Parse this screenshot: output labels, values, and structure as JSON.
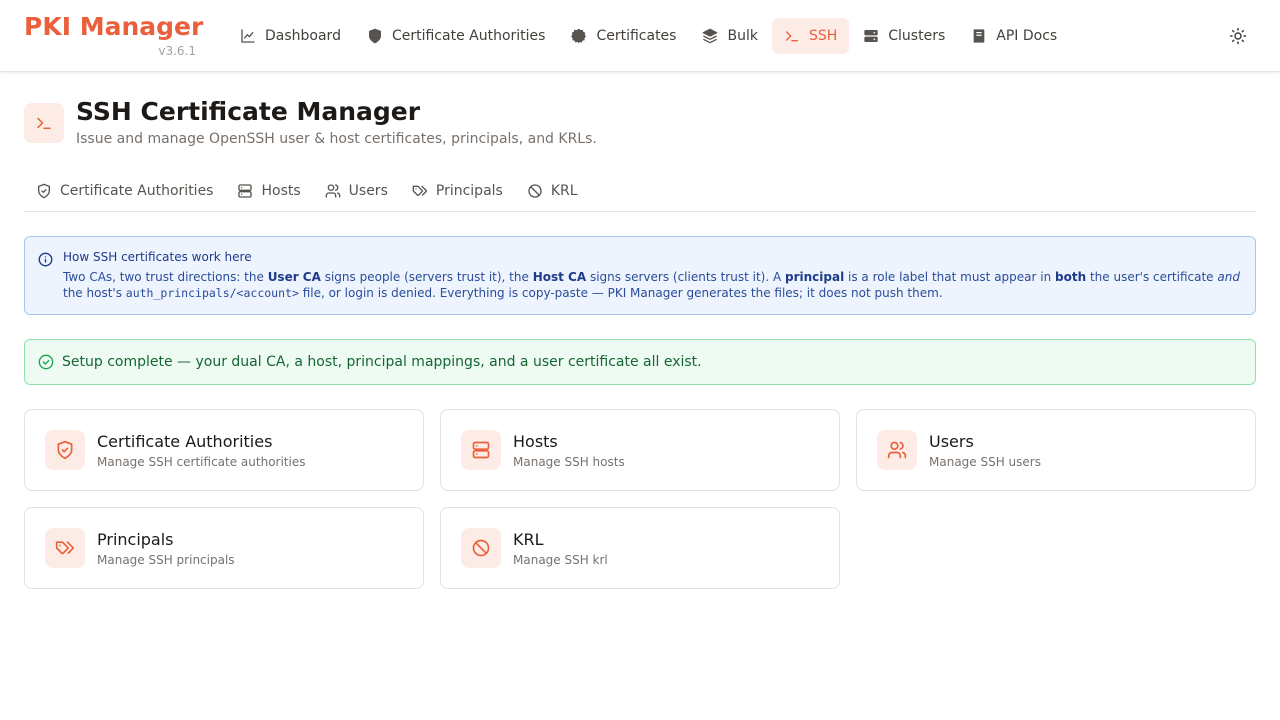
{
  "app": {
    "title": "PKI Manager",
    "version": "v3.6.1"
  },
  "nav": {
    "items": [
      {
        "label": "Dashboard",
        "icon": "chart-line-icon"
      },
      {
        "label": "Certificate Authorities",
        "icon": "shield-icon"
      },
      {
        "label": "Certificates",
        "icon": "badge-icon"
      },
      {
        "label": "Bulk",
        "icon": "layers-icon"
      },
      {
        "label": "SSH",
        "icon": "terminal-icon",
        "active": true
      },
      {
        "label": "Clusters",
        "icon": "server-icon"
      },
      {
        "label": "API Docs",
        "icon": "book-icon"
      }
    ],
    "theme_toggle": "sun-icon"
  },
  "page": {
    "title": "SSH Certificate Manager",
    "subtitle": "Issue and manage OpenSSH user & host certificates, principals, and KRLs."
  },
  "tabs": [
    {
      "label": "Certificate Authorities",
      "icon": "shield-check-icon"
    },
    {
      "label": "Hosts",
      "icon": "server-icon"
    },
    {
      "label": "Users",
      "icon": "users-icon"
    },
    {
      "label": "Principals",
      "icon": "tags-icon"
    },
    {
      "label": "KRL",
      "icon": "ban-icon"
    }
  ],
  "info": {
    "title": "How SSH certificates work here",
    "t1": "Two CAs, two trust directions: the ",
    "b1": "User CA",
    "t2": " signs people (servers trust it), the ",
    "b2": "Host CA",
    "t3": " signs servers (clients trust it). A ",
    "b3": "principal",
    "t4": " is a role label that must appear in ",
    "b4": "both",
    "t5": " the user's certificate ",
    "i1": "and",
    "t6": " the host's ",
    "code1": "auth_principals/<account>",
    "t7": " file, or login is denied. Everything is copy-paste — PKI Manager generates the files; it does not push them."
  },
  "success": {
    "message": "Setup complete — your dual CA, a host, principal mappings, and a user certificate all exist."
  },
  "cards": [
    {
      "title": "Certificate Authorities",
      "desc": "Manage SSH certificate authorities",
      "icon": "shield-check-icon"
    },
    {
      "title": "Hosts",
      "desc": "Manage SSH hosts",
      "icon": "server-icon"
    },
    {
      "title": "Users",
      "desc": "Manage SSH users",
      "icon": "users-icon"
    },
    {
      "title": "Principals",
      "desc": "Manage SSH principals",
      "icon": "tags-icon"
    },
    {
      "title": "KRL",
      "desc": "Manage SSH krl",
      "icon": "ban-icon"
    }
  ],
  "colors": {
    "accent": "#ea5f3c",
    "accent_bg": "#fdece5",
    "info_bg": "#eef4fe",
    "info_border": "#a9c7f1",
    "success_bg": "#eefbf3",
    "success_border": "#8fdfaf",
    "success_text": "#166534"
  }
}
